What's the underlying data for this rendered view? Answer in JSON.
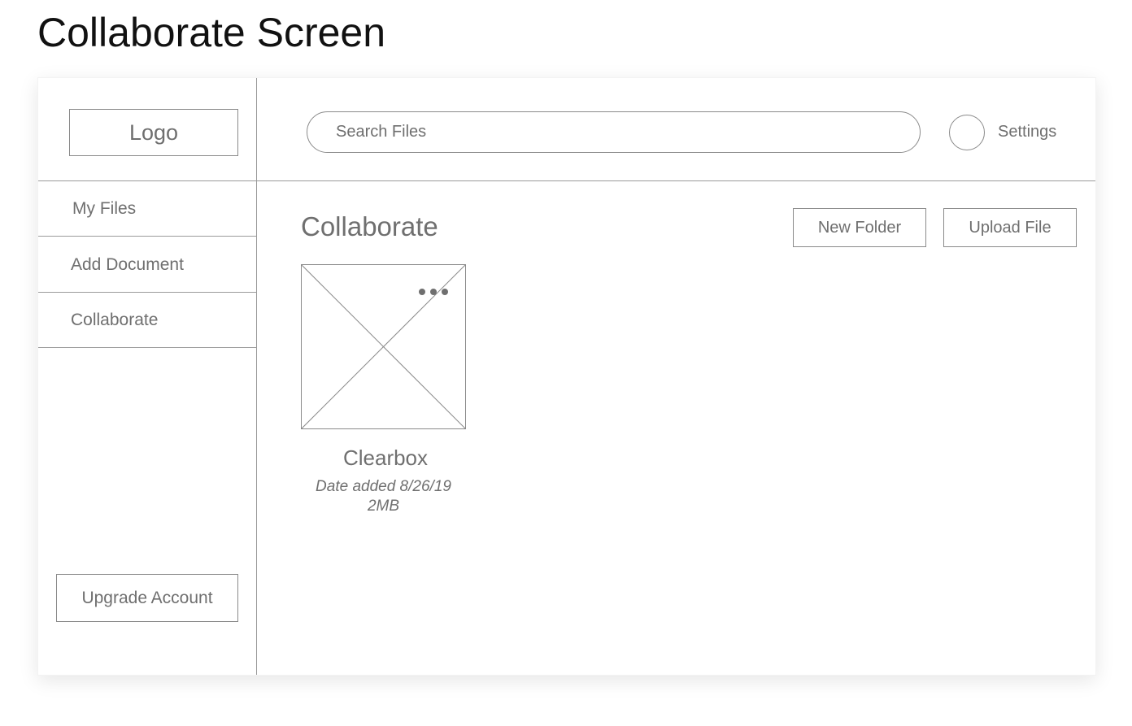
{
  "page": {
    "title": "Collaborate Screen"
  },
  "sidebar": {
    "logo_label": "Logo",
    "items": [
      {
        "label": "My Files"
      },
      {
        "label": "Add Document"
      },
      {
        "label": "Collaborate"
      }
    ],
    "upgrade_label": "Upgrade Account"
  },
  "topbar": {
    "search_placeholder": "Search Files",
    "settings_label": "Settings"
  },
  "main": {
    "title": "Collaborate",
    "new_folder_label": "New Folder",
    "upload_file_label": "Upload File",
    "files": [
      {
        "name": "Clearbox",
        "date_added": "Date added 8/26/19",
        "size": "2MB"
      }
    ]
  },
  "colors": {
    "text": "#6f6f6f",
    "border": "#8a8a8a",
    "title": "#111111"
  },
  "icons": {
    "avatar": "avatar-circle-icon",
    "more": "more-dots-icon",
    "thumbnail": "image-placeholder-icon"
  }
}
